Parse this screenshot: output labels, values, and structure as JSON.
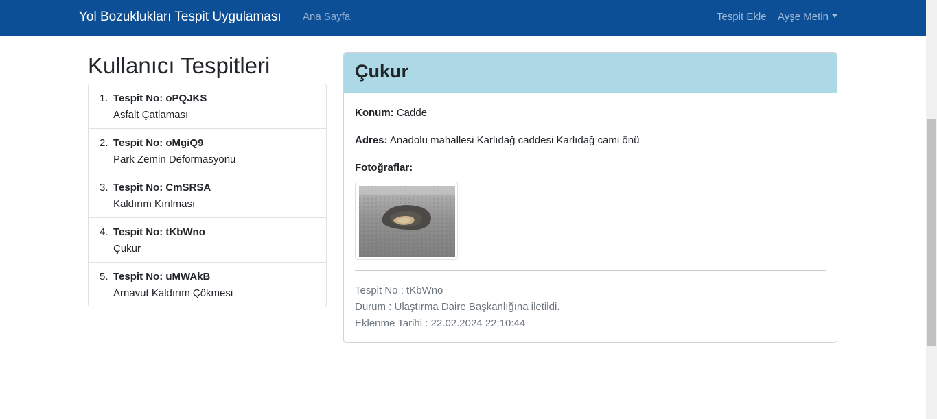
{
  "navbar": {
    "brand": "Yol Bozuklukları Tespit Uygulaması",
    "home": "Ana Sayfa",
    "add": "Tespit Ekle",
    "user": "Ayşe Metin",
    "bg_color": "#0d4f96"
  },
  "sidebar": {
    "title": "Kullanıcı Tespitleri",
    "items": [
      {
        "num": "1.",
        "title": "Tespit No: oPQJKS",
        "type": "Asfalt Çatlaması"
      },
      {
        "num": "2.",
        "title": "Tespit No: oMgiQ9",
        "type": "Park Zemin Deformasyonu"
      },
      {
        "num": "3.",
        "title": "Tespit No: CmSRSA",
        "type": "Kaldırım Kırılması"
      },
      {
        "num": "4.",
        "title": "Tespit No: tKbWno",
        "type": "Çukur"
      },
      {
        "num": "5.",
        "title": "Tespit No: uMWAkB",
        "type": "Arnavut Kaldırım Çökmesi"
      }
    ]
  },
  "detail": {
    "title": "Çukur",
    "header_color": "#add8e6",
    "location_label": "Konum:",
    "location_value": "Cadde",
    "address_label": "Adres:",
    "address_value": "Anadolu mahallesi Karlıdağ caddesi Karlıdağ cami önü",
    "photos_label": "Fotoğraflar:",
    "tespit_no": "Tespit No : tKbWno",
    "status": "Durum : Ulaştırma Daire Başkanlığına iletildi.",
    "date": "Eklenme Tarihi : 22.02.2024 22:10:44"
  }
}
